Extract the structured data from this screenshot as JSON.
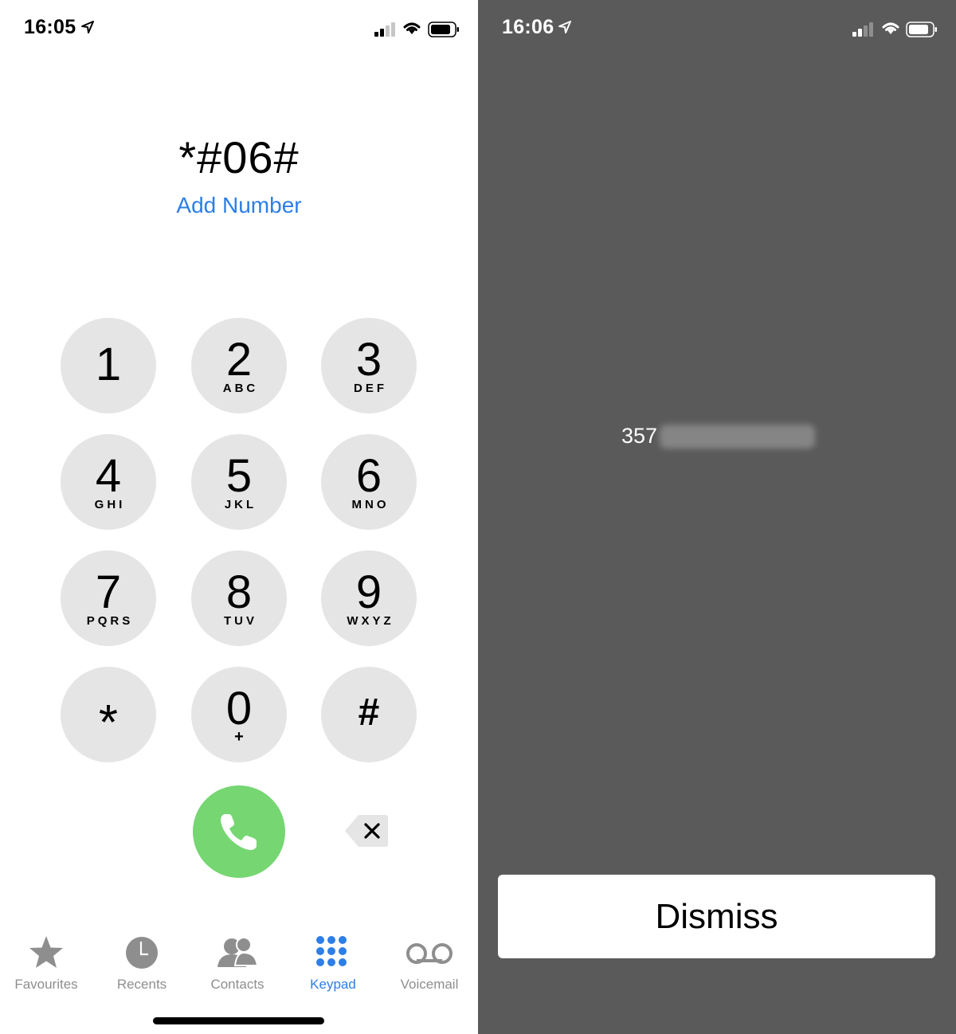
{
  "left_screen": {
    "status_bar": {
      "time": "16:05"
    },
    "dialed_number": "*#06#",
    "add_number_label": "Add Number",
    "keypad": [
      {
        "digit": "1",
        "letters": ""
      },
      {
        "digit": "2",
        "letters": "ABC"
      },
      {
        "digit": "3",
        "letters": "DEF"
      },
      {
        "digit": "4",
        "letters": "GHI"
      },
      {
        "digit": "5",
        "letters": "JKL"
      },
      {
        "digit": "6",
        "letters": "MNO"
      },
      {
        "digit": "7",
        "letters": "PQRS"
      },
      {
        "digit": "8",
        "letters": "TUV"
      },
      {
        "digit": "9",
        "letters": "WXYZ"
      },
      {
        "digit": "*",
        "letters": ""
      },
      {
        "digit": "0",
        "letters": "+"
      },
      {
        "digit": "#",
        "letters": ""
      }
    ],
    "tab_bar": {
      "favourites": "Favourites",
      "recents": "Recents",
      "contacts": "Contacts",
      "keypad": "Keypad",
      "voicemail": "Voicemail",
      "active_tab": "keypad"
    },
    "icons": {
      "call": "phone-icon",
      "delete": "backspace-icon",
      "favourites": "star-icon",
      "recents": "clock-icon",
      "contacts": "people-icon",
      "keypad": "keypad-grid-icon",
      "voicemail": "voicemail-icon"
    }
  },
  "right_screen": {
    "status_bar": {
      "time": "16:06"
    },
    "imei_visible_prefix": "357",
    "dismiss_label": "Dismiss"
  },
  "colors": {
    "accent_blue": "#2d7ee6",
    "call_green": "#76d672",
    "key_gray": "#e5e5e5",
    "overlay_gray": "#5a5a5a",
    "tab_inactive": "#8e8e8e"
  }
}
